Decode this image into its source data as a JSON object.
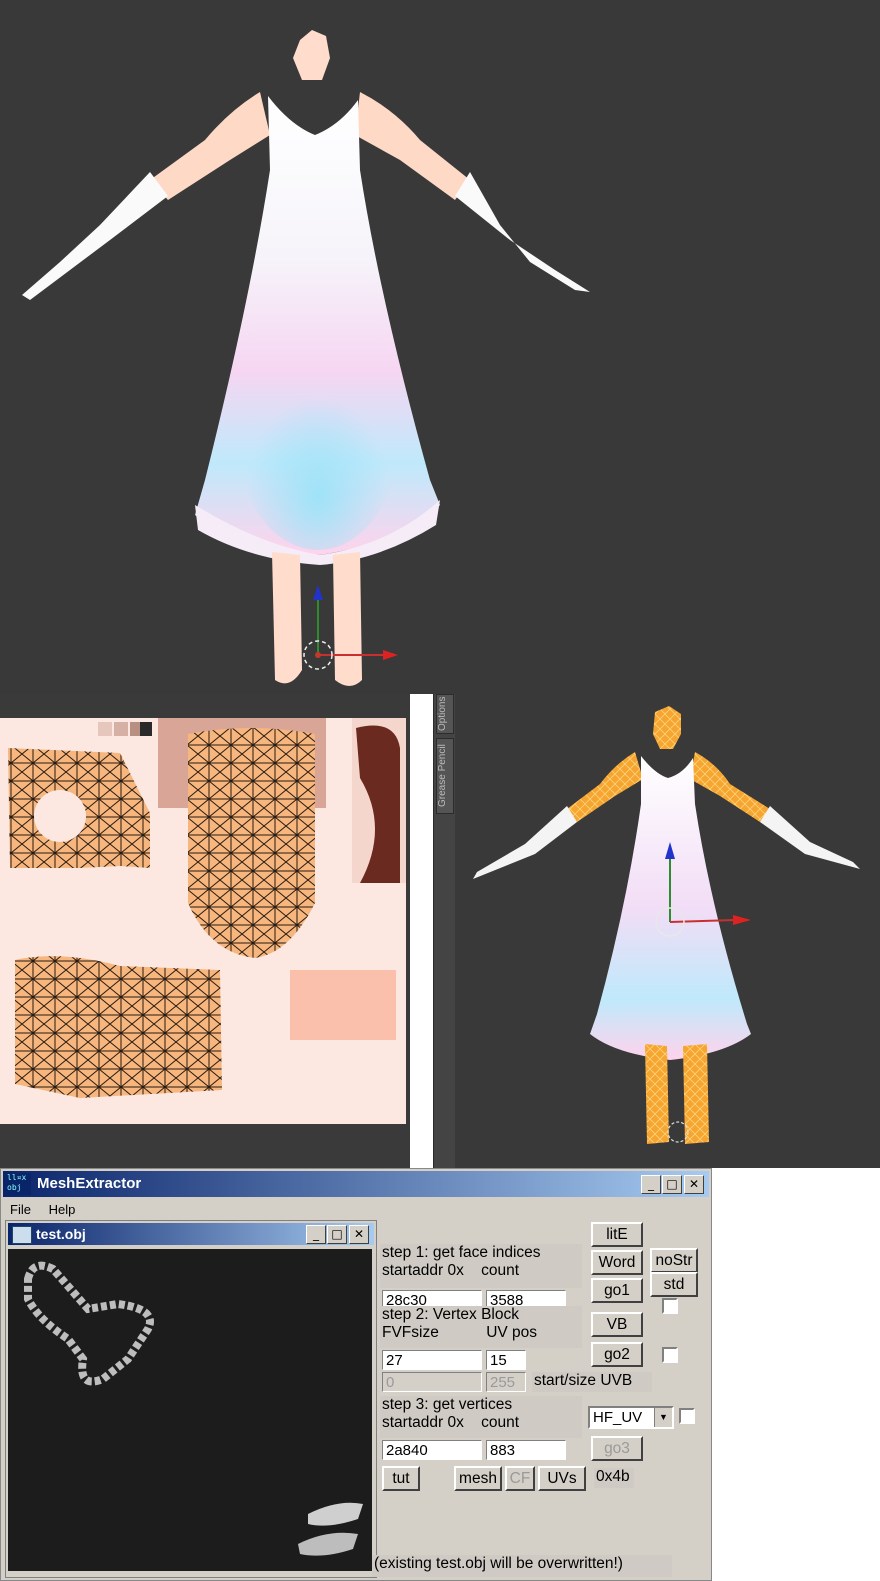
{
  "viewport_right": {
    "tabs": [
      "Options",
      "Grease Pencil"
    ]
  },
  "window": {
    "title": "MeshExtractor",
    "icon_text_top": "ll¤x",
    "icon_text_bottom": "obj",
    "controls": [
      "_",
      "□",
      "✕"
    ],
    "menu": [
      "File",
      "Help"
    ]
  },
  "child_window": {
    "title": "test.obj"
  },
  "step1": {
    "title": "step 1: get face indices",
    "col1": "startaddr 0x",
    "col2": "count",
    "startaddr": "28c30",
    "count": "3588"
  },
  "step2": {
    "title": "step 2: Vertex Block",
    "col1": "FVFsize",
    "col2": "UV pos",
    "fvfsize": "27",
    "uvpos": "15",
    "uvb_start": "0",
    "uvb_size": "255",
    "uvb_label": "start/size UVB"
  },
  "step3": {
    "title": "step 3: get vertices",
    "col1": "startaddr 0x",
    "col2": "count",
    "startaddr": "2a840",
    "count": "883",
    "format": "HF_UV"
  },
  "buttons": {
    "lite": "litE",
    "word": "Word",
    "nostr": "noStr",
    "std": "std",
    "go1": "go1",
    "vb": "VB",
    "go2": "go2",
    "go3": "go3",
    "tut": "tut",
    "mesh": "mesh",
    "cf": "CF",
    "uvs": "UVs"
  },
  "hex_value": "0x4b",
  "status": "(existing test.obj will be overwritten!)"
}
